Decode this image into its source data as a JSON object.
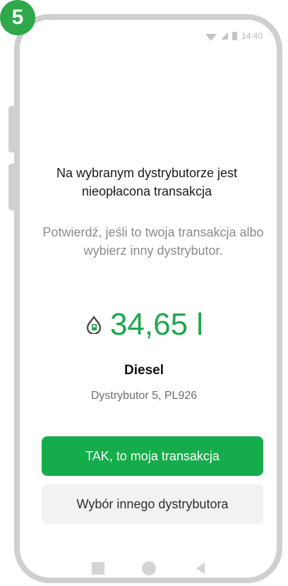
{
  "badge": {
    "number": "5"
  },
  "status_bar": {
    "time": "14:40"
  },
  "prompt": {
    "title": "Na wybranym dystrybutorze jest nieopłacona transakcja",
    "subtitle": "Potwierdź, jeśli to twoja transakcja albo wybierz inny dystrybutor."
  },
  "transaction": {
    "amount": "34,65 l",
    "fuel_type": "Diesel",
    "dispenser": "Dystrybutor 5, PL926"
  },
  "buttons": {
    "confirm": "TAK, to moja transakcja",
    "other": "Wybór innego dystrybutora"
  },
  "colors": {
    "accent": "#15ad4b",
    "amount": "#1fa84f"
  },
  "icons": {
    "fuel": "fuel-drop-icon",
    "nav": [
      "recents-icon",
      "home-icon",
      "back-icon"
    ]
  }
}
